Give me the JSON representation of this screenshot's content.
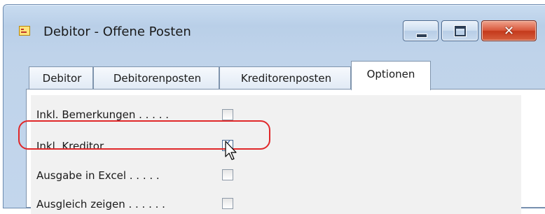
{
  "window": {
    "title": "Debitor - Offene Posten",
    "icon": "app-form-icon",
    "controls": {
      "minimize_icon": "minimize-icon",
      "maximize_icon": "maximize-icon",
      "close_glyph": "✕"
    },
    "accent_color": "#c4391b"
  },
  "tabs": [
    {
      "label": "Debitor",
      "active": false
    },
    {
      "label": "Debitorenposten",
      "active": false
    },
    {
      "label": "Kreditorenposten",
      "active": false
    },
    {
      "label": "Optionen",
      "active": true
    }
  ],
  "options": [
    {
      "label": "Inkl. Bemerkungen . . . . .",
      "checked": false
    },
    {
      "label": "Inkl. Kreditor . . . . . . . .",
      "checked": true
    },
    {
      "label": "Ausgabe in Excel . . . . .",
      "checked": false
    },
    {
      "label": "Ausgleich zeigen . . . . . .",
      "checked": false
    }
  ],
  "annotation": {
    "highlight_color": "#e0282a",
    "check_glyph": "✓"
  }
}
